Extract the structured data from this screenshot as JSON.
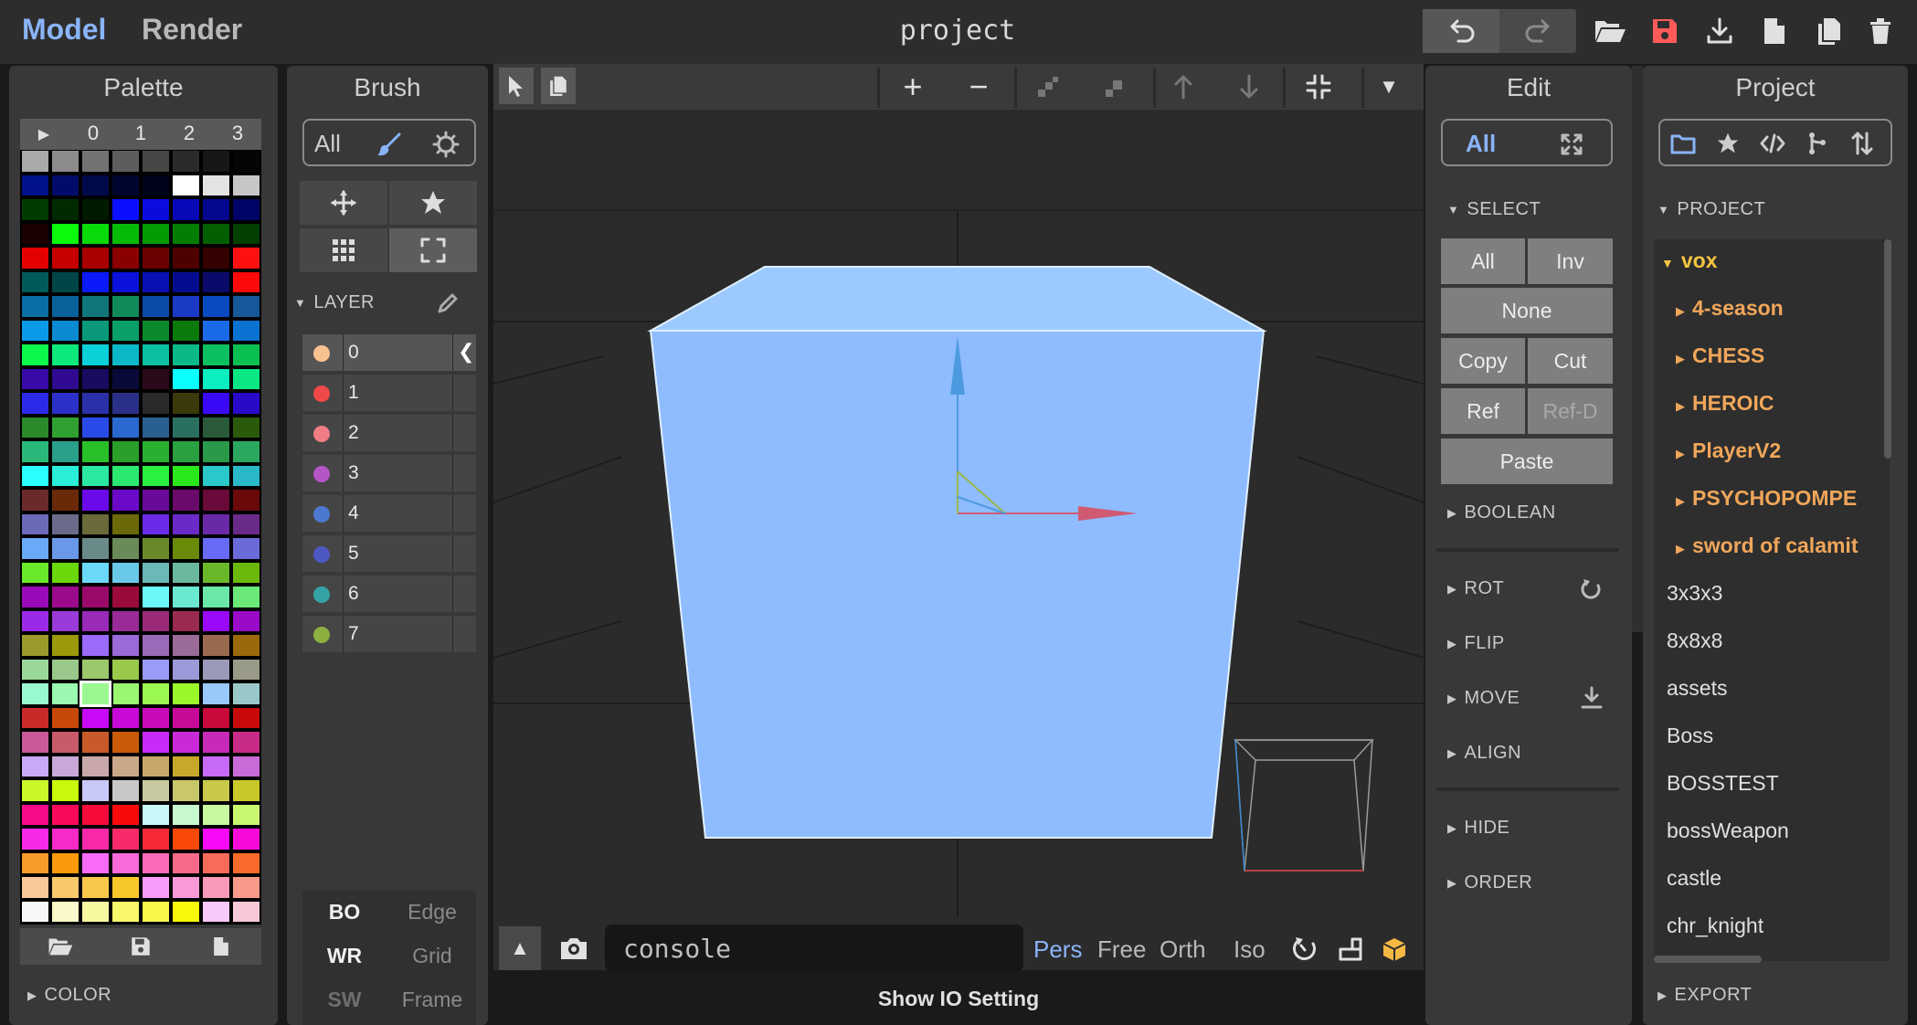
{
  "topbar": {
    "model_tab": "Model",
    "render_tab": "Render",
    "title": "project"
  },
  "palette": {
    "title": "Palette",
    "tabs": [
      "0",
      "1",
      "2",
      "3"
    ],
    "color_section": "COLOR",
    "colors": [
      "#a9a9a9",
      "#8b8b8b",
      "#737373",
      "#5d5d5d",
      "#464646",
      "#2b2b2b",
      "#171717",
      "#050505",
      "#00118a",
      "#000b6a",
      "#000a4a",
      "#000630",
      "#00041a",
      "#ffffff",
      "#e3e3e3",
      "#c6c6c6",
      "#003b00",
      "#002b00",
      "#001a00",
      "#0a10ff",
      "#0a0cde",
      "#0908b9",
      "#05078f",
      "#000466",
      "#1a0000",
      "#0cf80c",
      "#08d908",
      "#06bb06",
      "#049b04",
      "#037e03",
      "#025f02",
      "#014001",
      "#e50000",
      "#c60000",
      "#a80000",
      "#8a0000",
      "#6b0000",
      "#4e0000",
      "#350000",
      "#fe1010",
      "#005a5a",
      "#004648",
      "#0c19fb",
      "#0a12d9",
      "#0810b3",
      "#060c8f",
      "#0a0a6a",
      "#ff0a0a",
      "#0a6ea6",
      "#0a629a",
      "#10767a",
      "#118a5a",
      "#0a4aa8",
      "#1a3ac6",
      "#0a4ac0",
      "#16589a",
      "#0a9ae8",
      "#0a8ad0",
      "#0a9a7a",
      "#0aa06a",
      "#0a8a2a",
      "#0a7a0a",
      "#1a6ae8",
      "#0a72d0",
      "#0cf84a",
      "#0ce87a",
      "#0ad0d8",
      "#0ab8c8",
      "#0ac0a0",
      "#0ab888",
      "#0ac060",
      "#0ac050",
      "#380aa8",
      "#300a90",
      "#1a0a60",
      "#0a0a3a",
      "#2a0a1a",
      "#0affff",
      "#0aeec0",
      "#0ae884",
      "#2a2ae8",
      "#2a30c8",
      "#2a30a8",
      "#2a3088",
      "#2a2a2a",
      "#3a3a0a",
      "#3a0af8",
      "#2a0ac8",
      "#2a8a2a",
      "#30a030",
      "#2a4ae8",
      "#2a6ad0",
      "#2a6090",
      "#2a7060",
      "#2a5a3a",
      "#2a5a0a",
      "#2ab87a",
      "#2aa08a",
      "#2ac02a",
      "#2aa02a",
      "#2ab030",
      "#2aa040",
      "#2a9a4a",
      "#2aa860",
      "#2affff",
      "#2aeed8",
      "#2ae8a0",
      "#2ae870",
      "#2af040",
      "#2ae81a",
      "#2ac8c8",
      "#2ab8c8",
      "#6a2a2a",
      "#6a2a0a",
      "#6a0ae8",
      "#6a0ac8",
      "#6a0a9a",
      "#6a0a6a",
      "#6a0a3a",
      "#6a0a0a",
      "#6a6ab8",
      "#6a6a8a",
      "#6a6a3a",
      "#6a6a0a",
      "#6a2ae8",
      "#6a2ac8",
      "#6a2aa8",
      "#6a2a88",
      "#6aa8f8",
      "#6a98e8",
      "#6a8a8a",
      "#6a8a5a",
      "#6a8a2a",
      "#6a8a0a",
      "#6a6af8",
      "#6a6ad8",
      "#6ae82a",
      "#6ad80a",
      "#6ad8f8",
      "#6ac8e8",
      "#6ab8b8",
      "#6ab8a0",
      "#6ab82a",
      "#6ab80a",
      "#9a0ab8",
      "#9a0a8a",
      "#9a0a6a",
      "#9a0a3a",
      "#6af8f8",
      "#6ae8d0",
      "#6ae8a8",
      "#6ae878",
      "#9a2ae8",
      "#9a3ad8",
      "#9a2ab8",
      "#9a2a98",
      "#9a2a78",
      "#9a2a50",
      "#9a0af8",
      "#9a0ac8",
      "#9a9a2a",
      "#9a9a0a",
      "#9a6af8",
      "#9a6ad8",
      "#9a6ab8",
      "#9a6a98",
      "#9a6a50",
      "#9a6a0a",
      "#9ad89a",
      "#9ac88a",
      "#9ac86a",
      "#9ac84a",
      "#9a9af8",
      "#9a9ad8",
      "#9a9ab8",
      "#9a9a88",
      "#9af8d0",
      "#9af8b0",
      "#9af890",
      "#9af870",
      "#9af850",
      "#9af82a",
      "#9ac8f8",
      "#9ac8c8",
      "#c82a2a",
      "#c8480a",
      "#c80af8",
      "#c80ad8",
      "#c80ab8",
      "#c80a98",
      "#c80a3a",
      "#c80a0a",
      "#c85a9a",
      "#c85a6a",
      "#c85a2a",
      "#c85a0a",
      "#c82af8",
      "#c82ad8",
      "#c82ab8",
      "#c82a88",
      "#c8a8f8",
      "#c8a8d8",
      "#c8a8a8",
      "#c8a888",
      "#c8a86a",
      "#c8a82a",
      "#c86af8",
      "#c86ad8",
      "#c8f82a",
      "#c8f80a",
      "#c8c8f8",
      "#c8c8c8",
      "#c8c8a0",
      "#c8c86a",
      "#c8c84a",
      "#c8c82a",
      "#f80a8a",
      "#f80a5a",
      "#f80a3a",
      "#f80a0a",
      "#c8f8f8",
      "#c8f8d0",
      "#c8f8a0",
      "#c8f870",
      "#f82ae8",
      "#f82ac8",
      "#f82aa8",
      "#f82a6a",
      "#f82a3a",
      "#f8480a",
      "#f80af8",
      "#f80ad8",
      "#f89a2a",
      "#f89a0a",
      "#f86af8",
      "#f86ad8",
      "#f86ab8",
      "#f86a8a",
      "#f86a5a",
      "#f86a2a",
      "#f8c89a",
      "#f8c86a",
      "#f8c84a",
      "#f8c82a",
      "#f89af8",
      "#f89ad8",
      "#f89ab8",
      "#f89a8a",
      "#f8f8f8",
      "#f8f8c8",
      "#f8f8a0",
      "#f8f86a",
      "#f8f84a",
      "#f8f80a",
      "#f8c8f8",
      "#f8c8d8"
    ],
    "selected_index": 178
  },
  "brush": {
    "title": "Brush",
    "mode_all": "All",
    "layer_section": "LAYER",
    "layers": [
      {
        "label": "0",
        "color": "#f8c290"
      },
      {
        "label": "1",
        "color": "#f04848"
      },
      {
        "label": "2",
        "color": "#f07c84"
      },
      {
        "label": "3",
        "color": "#b656c6"
      },
      {
        "label": "4",
        "color": "#4c78d0"
      },
      {
        "label": "5",
        "color": "#4e58c4"
      },
      {
        "label": "6",
        "color": "#33a3a6"
      },
      {
        "label": "7",
        "color": "#8cb040"
      }
    ],
    "bottom_rows": [
      {
        "a": "BO",
        "b": "Edge"
      },
      {
        "a": "WR",
        "b": "Grid"
      },
      {
        "a": "SW",
        "b": "Frame"
      }
    ]
  },
  "viewport": {
    "console_placeholder": "console",
    "view_modes": [
      "Pers",
      "Free",
      "Orth",
      "Iso"
    ],
    "active_view": "Pers",
    "show_io_label": "Show IO Setting"
  },
  "edit": {
    "title": "Edit",
    "mode_all": "All",
    "select_section": "SELECT",
    "btn_all": "All",
    "btn_inv": "Inv",
    "btn_none": "None",
    "btn_copy": "Copy",
    "btn_cut": "Cut",
    "btn_ref": "Ref",
    "btn_ref_d": "Ref-D",
    "btn_paste": "Paste",
    "boolean_section": "BOOLEAN",
    "rot_section": "ROT",
    "flip_section": "FLIP",
    "move_section": "MOVE",
    "align_section": "ALIGN",
    "hide_section": "HIDE",
    "order_section": "ORDER"
  },
  "project": {
    "title": "Project",
    "section": "PROJECT",
    "export_section": "EXPORT",
    "root": "vox",
    "folders": [
      "4-season",
      "CHESS",
      "HEROIC",
      "PlayerV2",
      "PSYCHOPOMPE",
      "sword of calamit"
    ],
    "files": [
      "3x3x3",
      "8x8x8",
      "assets",
      "Boss",
      "BOSSTEST",
      "bossWeapon",
      "castle",
      "chr_knight"
    ]
  }
}
